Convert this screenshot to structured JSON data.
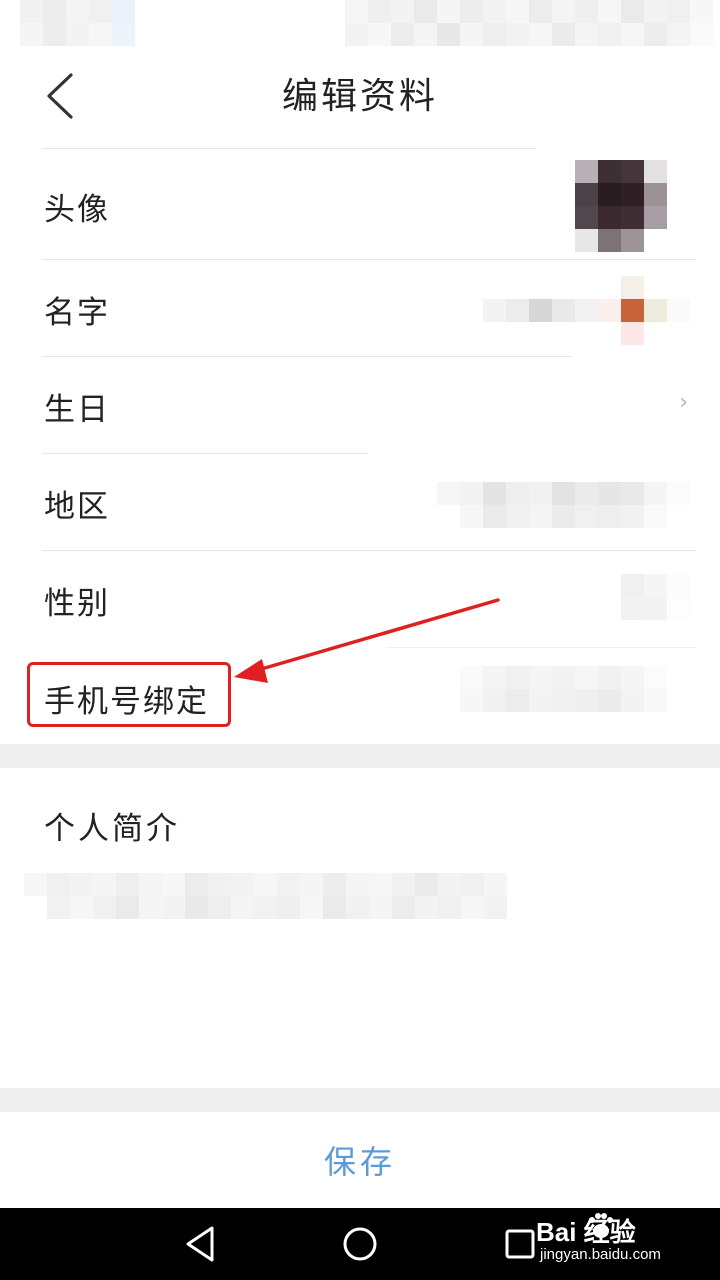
{
  "header": {
    "title": "编辑资料",
    "back_icon": "chevron-left-icon"
  },
  "rows": [
    {
      "key": "avatar",
      "label": "头像"
    },
    {
      "key": "name",
      "label": "名字"
    },
    {
      "key": "birthday",
      "label": "生日",
      "chevron": "›"
    },
    {
      "key": "region",
      "label": "地区"
    },
    {
      "key": "gender",
      "label": "性别"
    },
    {
      "key": "phone",
      "label": "手机号绑定"
    }
  ],
  "bio": {
    "label": "个人简介"
  },
  "actions": {
    "save_label": "保存"
  },
  "watermark": {
    "top": "Bai 经验",
    "bottom": "jingyan.baidu.com"
  },
  "colors": {
    "accent": "#5b9bd6",
    "annotation": "#e02020",
    "separator": "#efefef",
    "text": "#222222"
  }
}
